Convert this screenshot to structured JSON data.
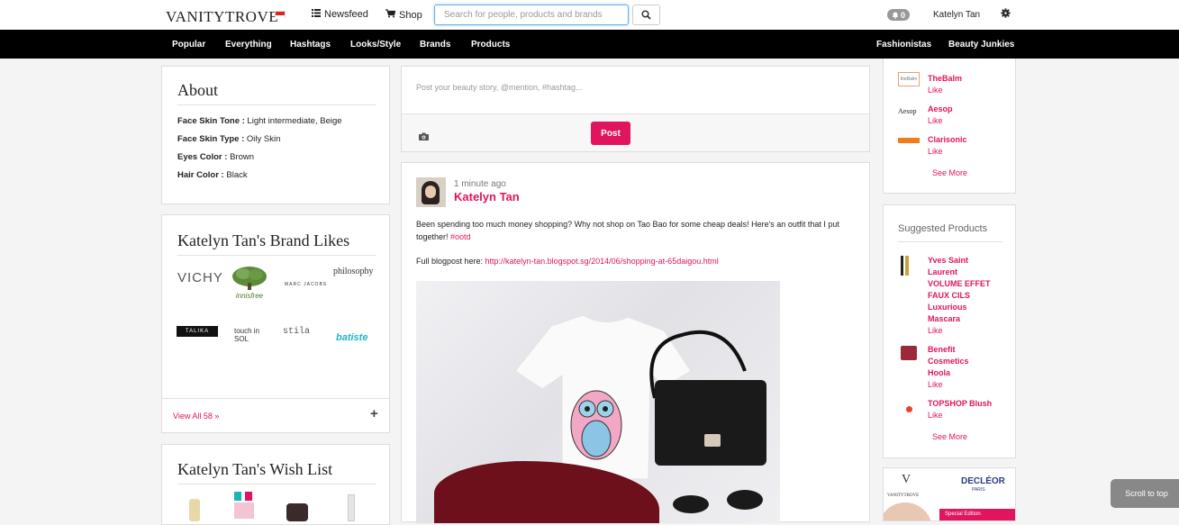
{
  "header": {
    "logo": "VANITYTROVE",
    "newsfeed": "Newsfeed",
    "shop": "Shop",
    "search_placeholder": "Search for people, products and brands",
    "notifications": "0",
    "user": "Katelyn Tan"
  },
  "nav": {
    "left": [
      "Popular",
      "Everything",
      "Hashtags",
      "Looks/Style",
      "Brands",
      "Products"
    ],
    "right": [
      "Fashionistas",
      "Beauty Junkies"
    ]
  },
  "about": {
    "title": "About",
    "rows": [
      {
        "label": "Face Skin Tone :",
        "value": " Light intermediate, Beige"
      },
      {
        "label": "Face Skin Type :",
        "value": " Oily Skin"
      },
      {
        "label": "Eyes Color :",
        "value": " Brown"
      },
      {
        "label": "Hair Color :",
        "value": " Black"
      }
    ]
  },
  "brand_likes": {
    "title": "Katelyn Tan's Brand Likes",
    "brands": [
      "VICHY",
      "innisfree",
      "MARC JACOBS",
      "philosophy",
      "TALIKA",
      "touch in SOL",
      "stila",
      "batiste"
    ],
    "view_all": "View All 58 »",
    "add": "+"
  },
  "wish_list": {
    "title": "Katelyn Tan's Wish List"
  },
  "composer": {
    "placeholder": "Post your beauty story, @mention, #hashtag...",
    "post_label": "Post"
  },
  "post": {
    "time": "1 minute ago",
    "author": "Katelyn Tan",
    "text": "Been spending too much money shopping? Why not shop on Tao Bao for some cheap deals! Here's an outfit that I put together! ",
    "hashtag": "#ootd",
    "blog_label": "Full blogpost here: ",
    "blog_url": "http://katelyn-tan.blogspot.sg/2014/06/shopping-at-65daigou.html"
  },
  "liked_brands": {
    "items": [
      {
        "name": "TheBalm",
        "like": "Like",
        "logo": "theBalm"
      },
      {
        "name": "Aesop",
        "like": "Like",
        "logo": "Aesop"
      },
      {
        "name": "Clarisonic",
        "like": "Like",
        "logo": ""
      }
    ],
    "see_more": "See More"
  },
  "suggested": {
    "title": "Suggested Products",
    "items": [
      {
        "name_lines": [
          "Yves Saint",
          "Laurent",
          "VOLUME EFFET",
          "FAUX CILS",
          "Luxurious",
          "Mascara"
        ],
        "like": "Like"
      },
      {
        "name_lines": [
          "Benefit",
          "Cosmetics",
          "Hoola"
        ],
        "like": "Like"
      },
      {
        "name_lines": [
          "TOPSHOP Blush"
        ],
        "like": "Like"
      }
    ],
    "see_more": "See More"
  },
  "ad": {
    "brand1": "VANITYTROVE",
    "brand2": "DECLÉOR",
    "brand2_sub": "PARIS",
    "badge": "Special Edition"
  },
  "scroll_top": "Scroll to top",
  "colors": {
    "accent": "#e0145f",
    "nav_bg": "#000000"
  }
}
